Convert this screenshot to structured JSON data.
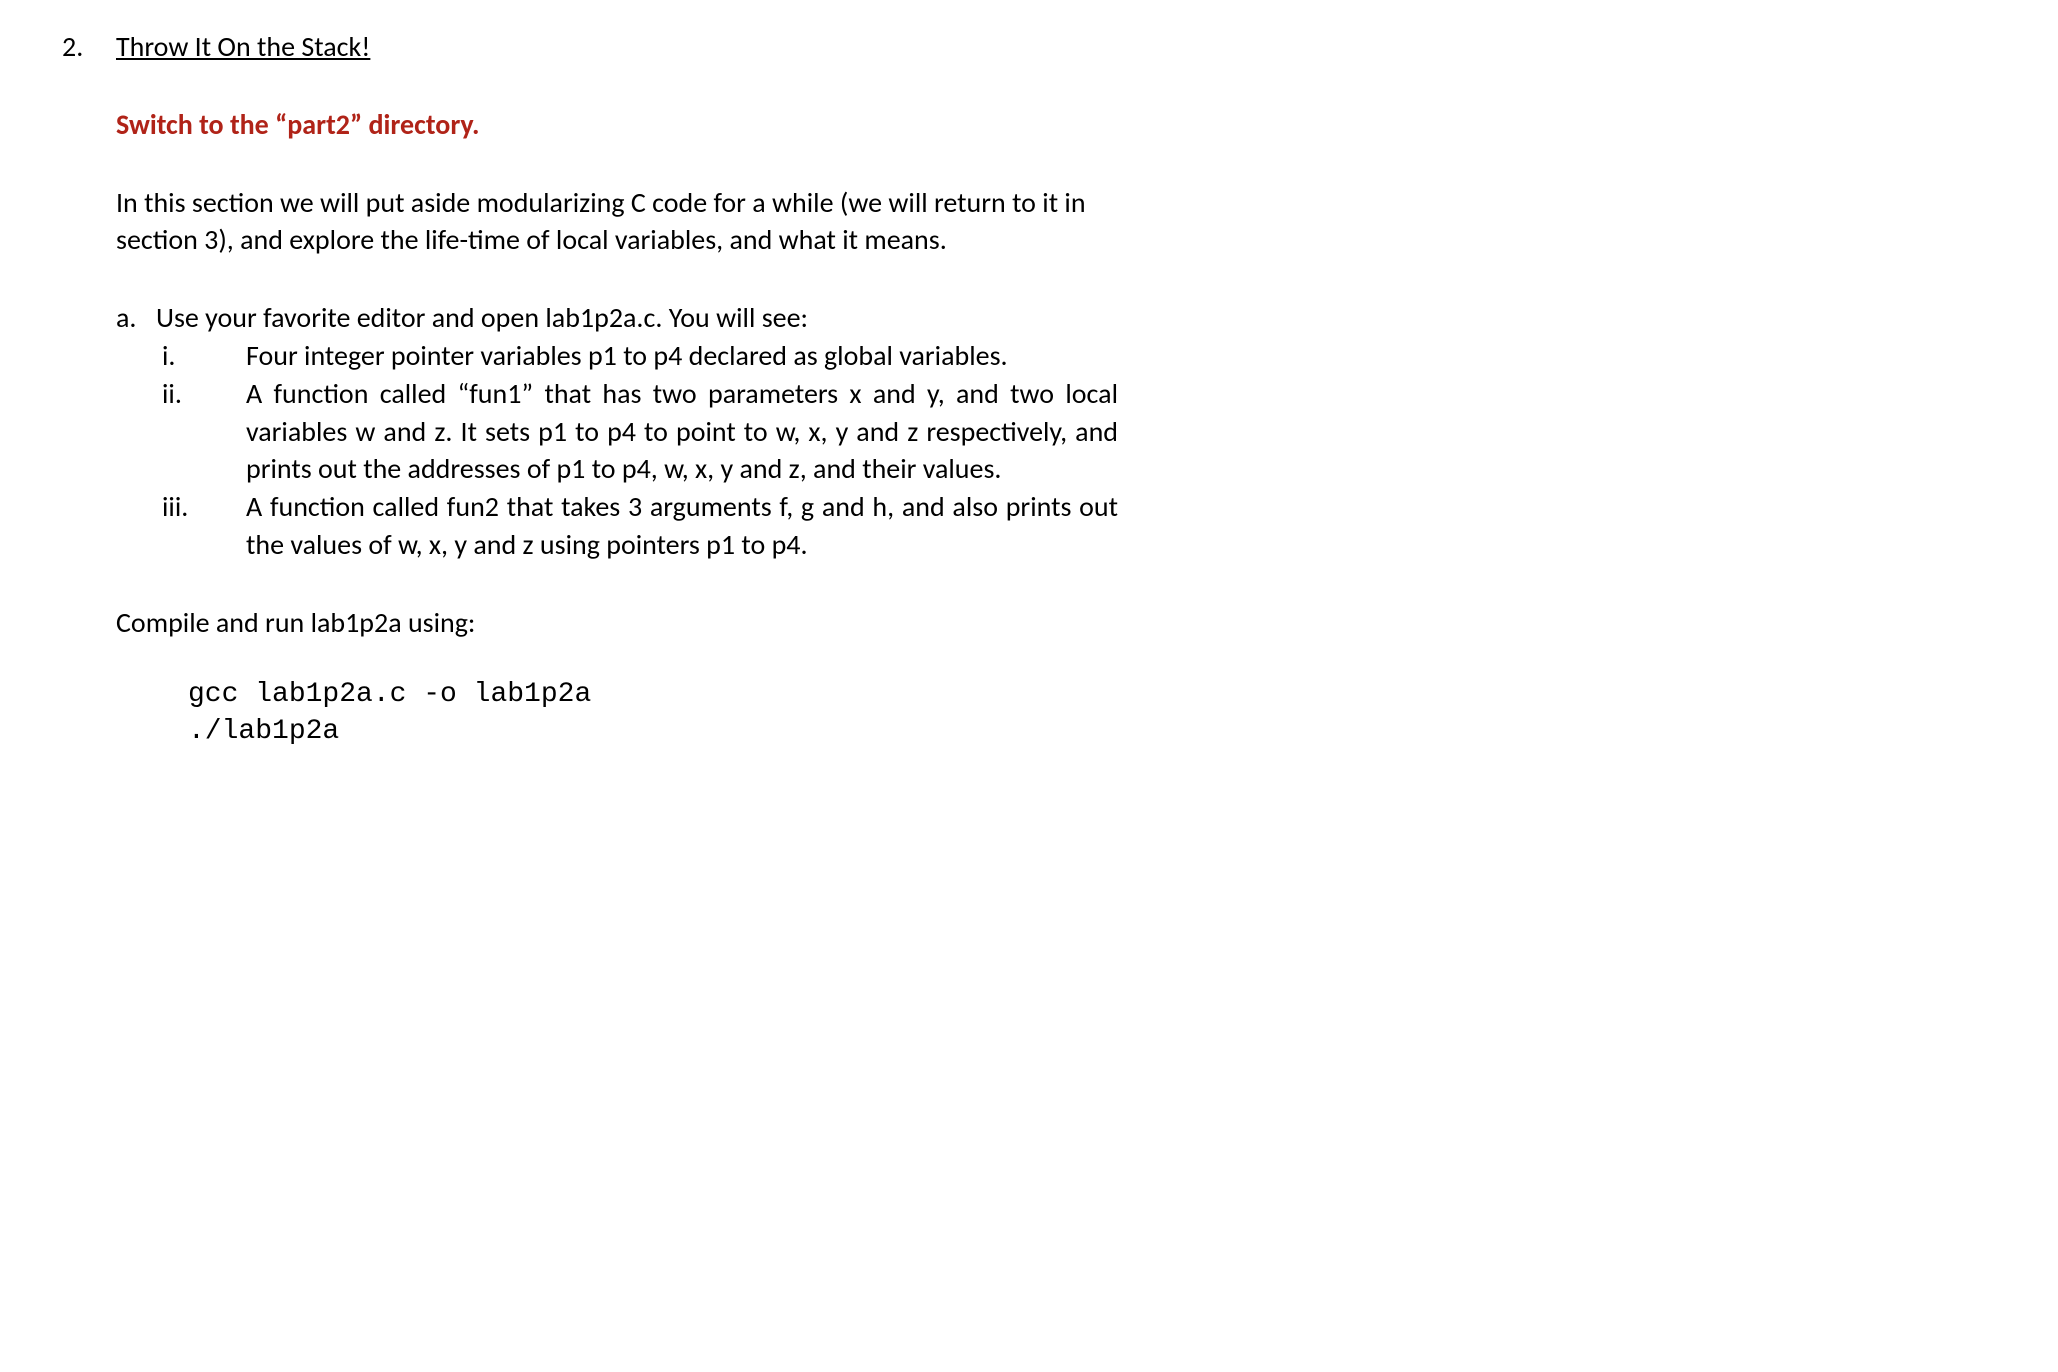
{
  "main": {
    "marker": "2.",
    "heading": "Throw It On the Stack!",
    "instruction": "Switch to the “part2” directory.",
    "intro": "In this section we will put aside modularizing C code for a while (we will return to it in section 3), and explore the life-time of local variables, and what it means.",
    "sub": {
      "marker": "a.",
      "lead": "Use your favorite editor and open lab1p2a.c. You will see:",
      "items": [
        {
          "marker": "i.",
          "text": "Four integer pointer variables p1 to p4 declared as global variables."
        },
        {
          "marker": "ii.",
          "text": "A function called “fun1” that has two parameters x and y, and two local variables w and z. It sets p1 to p4 to point to w, x, y and z respectively, and prints out the addresses of p1 to p4, w, x, y and z, and their values."
        },
        {
          "marker": "iii.",
          "text": "A function called fun2 that takes 3 arguments f, g and h, and also prints out the values of w, x, y and z using pointers p1 to p4."
        }
      ],
      "compile_text": "Compile and run lab1p2a using:",
      "code": "gcc lab1p2a.c -o lab1p2a\n./lab1p2a"
    }
  }
}
